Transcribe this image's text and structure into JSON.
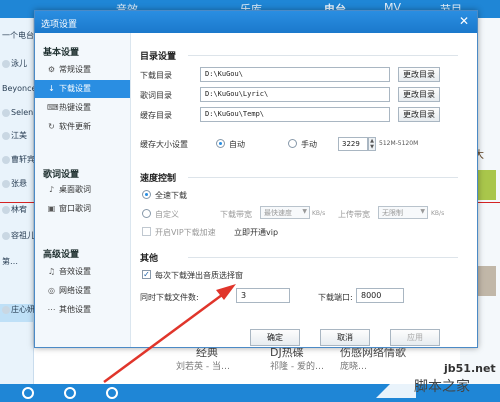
{
  "background": {
    "header_tabs": [
      "乐库",
      "电台",
      "MV",
      "节目"
    ],
    "header_volume": "音效",
    "left_pane_items": [
      "一个电台",
      "泳儿",
      "Beyonce",
      "Selen",
      "江美",
      "曹轩宾",
      "张悬",
      "林宥",
      "容祖儿",
      "第…",
      "庄心妍"
    ],
    "right_label": "大",
    "bottom_titles": [
      "经典",
      "DJ热碟",
      "伤感网络情歌"
    ],
    "bottom_subs": [
      "刘若英 - 当…",
      "祁隆 - 爱的…",
      "庞晓…"
    ]
  },
  "dialog": {
    "title": "选项设置",
    "close_glyph": "✕"
  },
  "nav": {
    "groups": [
      {
        "label": "基本设置",
        "items": [
          {
            "label": "常规设置",
            "icon": "⚙"
          },
          {
            "label": "下载设置",
            "icon": "↓"
          },
          {
            "label": "热键设置",
            "icon": "⌨"
          },
          {
            "label": "软件更新",
            "icon": "↻"
          }
        ]
      },
      {
        "label": "歌词设置",
        "items": [
          {
            "label": "桌面歌词",
            "icon": "♪"
          },
          {
            "label": "窗口歌词",
            "icon": "▣"
          }
        ]
      },
      {
        "label": "高级设置",
        "items": [
          {
            "label": "音效设置",
            "icon": "♫"
          },
          {
            "label": "网络设置",
            "icon": "◎"
          },
          {
            "label": "其他设置",
            "icon": "⋯"
          }
        ]
      }
    ],
    "active": "下载设置"
  },
  "directories": {
    "section_title": "目录设置",
    "rows": [
      {
        "label": "下载目录",
        "value": "D:\\KuGou\\",
        "button": "更改目录"
      },
      {
        "label": "歌词目录",
        "value": "D:\\KuGou\\Lyric\\",
        "button": "更改目录"
      },
      {
        "label": "缓存目录",
        "value": "D:\\KuGou\\Temp\\",
        "button": "更改目录"
      }
    ],
    "cache_size_label": "缓存大小设置",
    "cache_auto": "自动",
    "cache_manual": "手动",
    "cache_value": "3229",
    "cache_range": "512M-5120M"
  },
  "speed": {
    "section_title": "速度控制",
    "full_speed": "全速下载",
    "custom": "自定义",
    "download_bw_label": "下载带宽",
    "download_bw_value": "最快速度",
    "download_unit": "KB/s",
    "upload_bw_label": "上传带宽",
    "upload_bw_value": "无限制",
    "upload_unit": "KB/s",
    "vip_label": "开启VIP下载加速",
    "vip_link": "立即开通vip"
  },
  "other": {
    "section_title": "其他",
    "popup_check_label": "每次下载弹出音质选择窗",
    "concurrent_label": "同时下载文件数:",
    "concurrent_value": "3",
    "port_label": "下载端口:",
    "port_value": "8000"
  },
  "footer": {
    "ok": "确定",
    "cancel": "取消",
    "apply": "应用"
  },
  "watermark": {
    "site": "jb51.net",
    "name": "脚本之家"
  },
  "colors": {
    "accent": "#2a8ee2",
    "annotation": "#e0352b"
  }
}
